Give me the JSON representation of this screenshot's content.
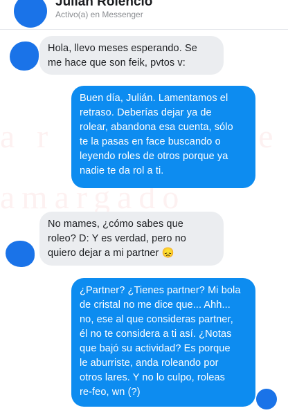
{
  "header": {
    "name": "Julián Rolencio",
    "status": "Activo(a) en Messenger"
  },
  "watermark": {
    "line1": "a r a c o c u e",
    "line2": "amargado"
  },
  "messages": [
    {
      "sender": "contact",
      "text": "Hola, llevo meses esperando.  Se\nme hace que son feik, pvtos v:"
    },
    {
      "sender": "me",
      "text": "Buen día, Julián.  Lamentamos el\nretraso.  Deberías dejar ya de\nrolear, abandona esa cuenta, sólo\nte la pasas en face buscando o\nleyendo roles de otros porque ya\nnadie te da rol a ti."
    },
    {
      "sender": "contact",
      "text": "No mames, ¿cómo sabes que\nroleo? D:  Y es verdad, pero no\nquiero dejar a mi partner 😞"
    },
    {
      "sender": "me",
      "text": "¿Partner? ¿Tienes partner? Mi bola\nde cristal no me dice que... Ahh...\nno, ese al que consideras partner,\nél no te considera a ti así.  ¿Notas\nque bajó su actividad? Es porque\nle aburriste, anda roleando por\notros lares.  Y no lo culpo, roleas\nre-feo, wn (?)"
    }
  ],
  "colors": {
    "outgoing_bubble": "#0d8cf0",
    "incoming_bubble": "#ebedf0",
    "avatar_mask": "#1a73e8"
  }
}
